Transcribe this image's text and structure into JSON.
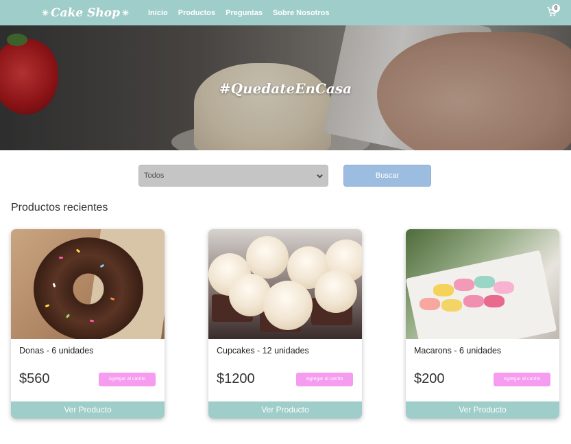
{
  "nav": {
    "logo_text": "Cake Shop",
    "links": [
      "Inicio",
      "Productos",
      "Preguntas",
      "Sobre Nosotros"
    ],
    "cart_count": "0",
    "bg_color": "#9fcdc9"
  },
  "hero": {
    "text": "#QuedateEnCasa"
  },
  "filter": {
    "selected": "Todos",
    "search_label": "Buscar"
  },
  "section_title": "Productos recientes",
  "products": [
    {
      "name": "Donas - 6 unidades",
      "price": "$560",
      "add_label": "Agregar al carrito",
      "view_label": "Ver Producto",
      "image_icon": "donut-image"
    },
    {
      "name": "Cupcakes - 12 unidades",
      "price": "$1200",
      "add_label": "Agregar al carrito",
      "view_label": "Ver Producto",
      "image_icon": "cupcakes-image"
    },
    {
      "name": "Macarons - 6 unidades",
      "price": "$200",
      "add_label": "Agregar al carrito",
      "view_label": "Ver Producto",
      "image_icon": "macarons-image"
    }
  ],
  "colors": {
    "accent": "#9fcdc9",
    "add_button": "#f59bf0",
    "search_button": "#9dbde0"
  }
}
